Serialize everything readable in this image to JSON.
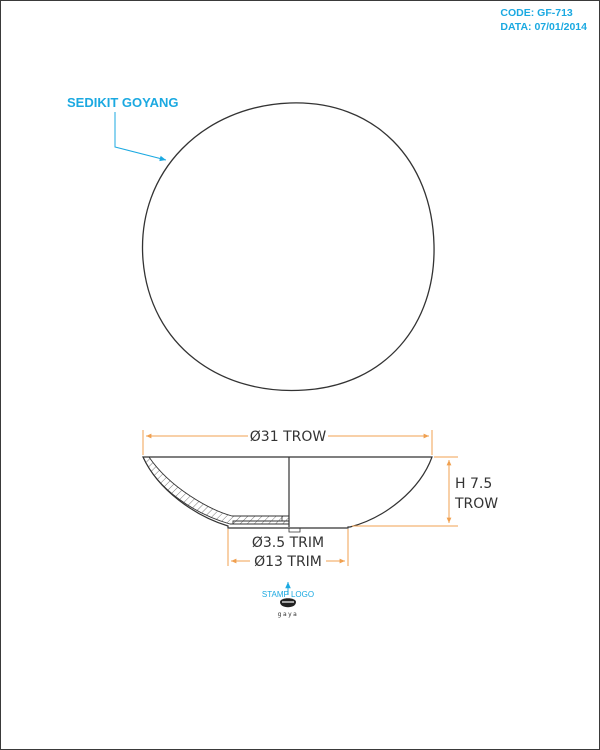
{
  "header": {
    "code": "CODE: GF-713",
    "date": "DATA: 07/01/2014"
  },
  "notes": {
    "top_view": "SEDIKIT GOYANG",
    "stamp": "STAMP LOGO",
    "logo_word": "gaya"
  },
  "dimensions": {
    "outer_diameter": "Ø31 TROW",
    "height_line1": "H 7.5",
    "height_line2": "TROW",
    "inner_foot_diameter": "Ø3.5 TRIM",
    "foot_diameter": "Ø13 TRIM"
  },
  "colors": {
    "dimension_line": "#f0a050",
    "annotation": "#1ba9e1",
    "outline": "#333333"
  }
}
